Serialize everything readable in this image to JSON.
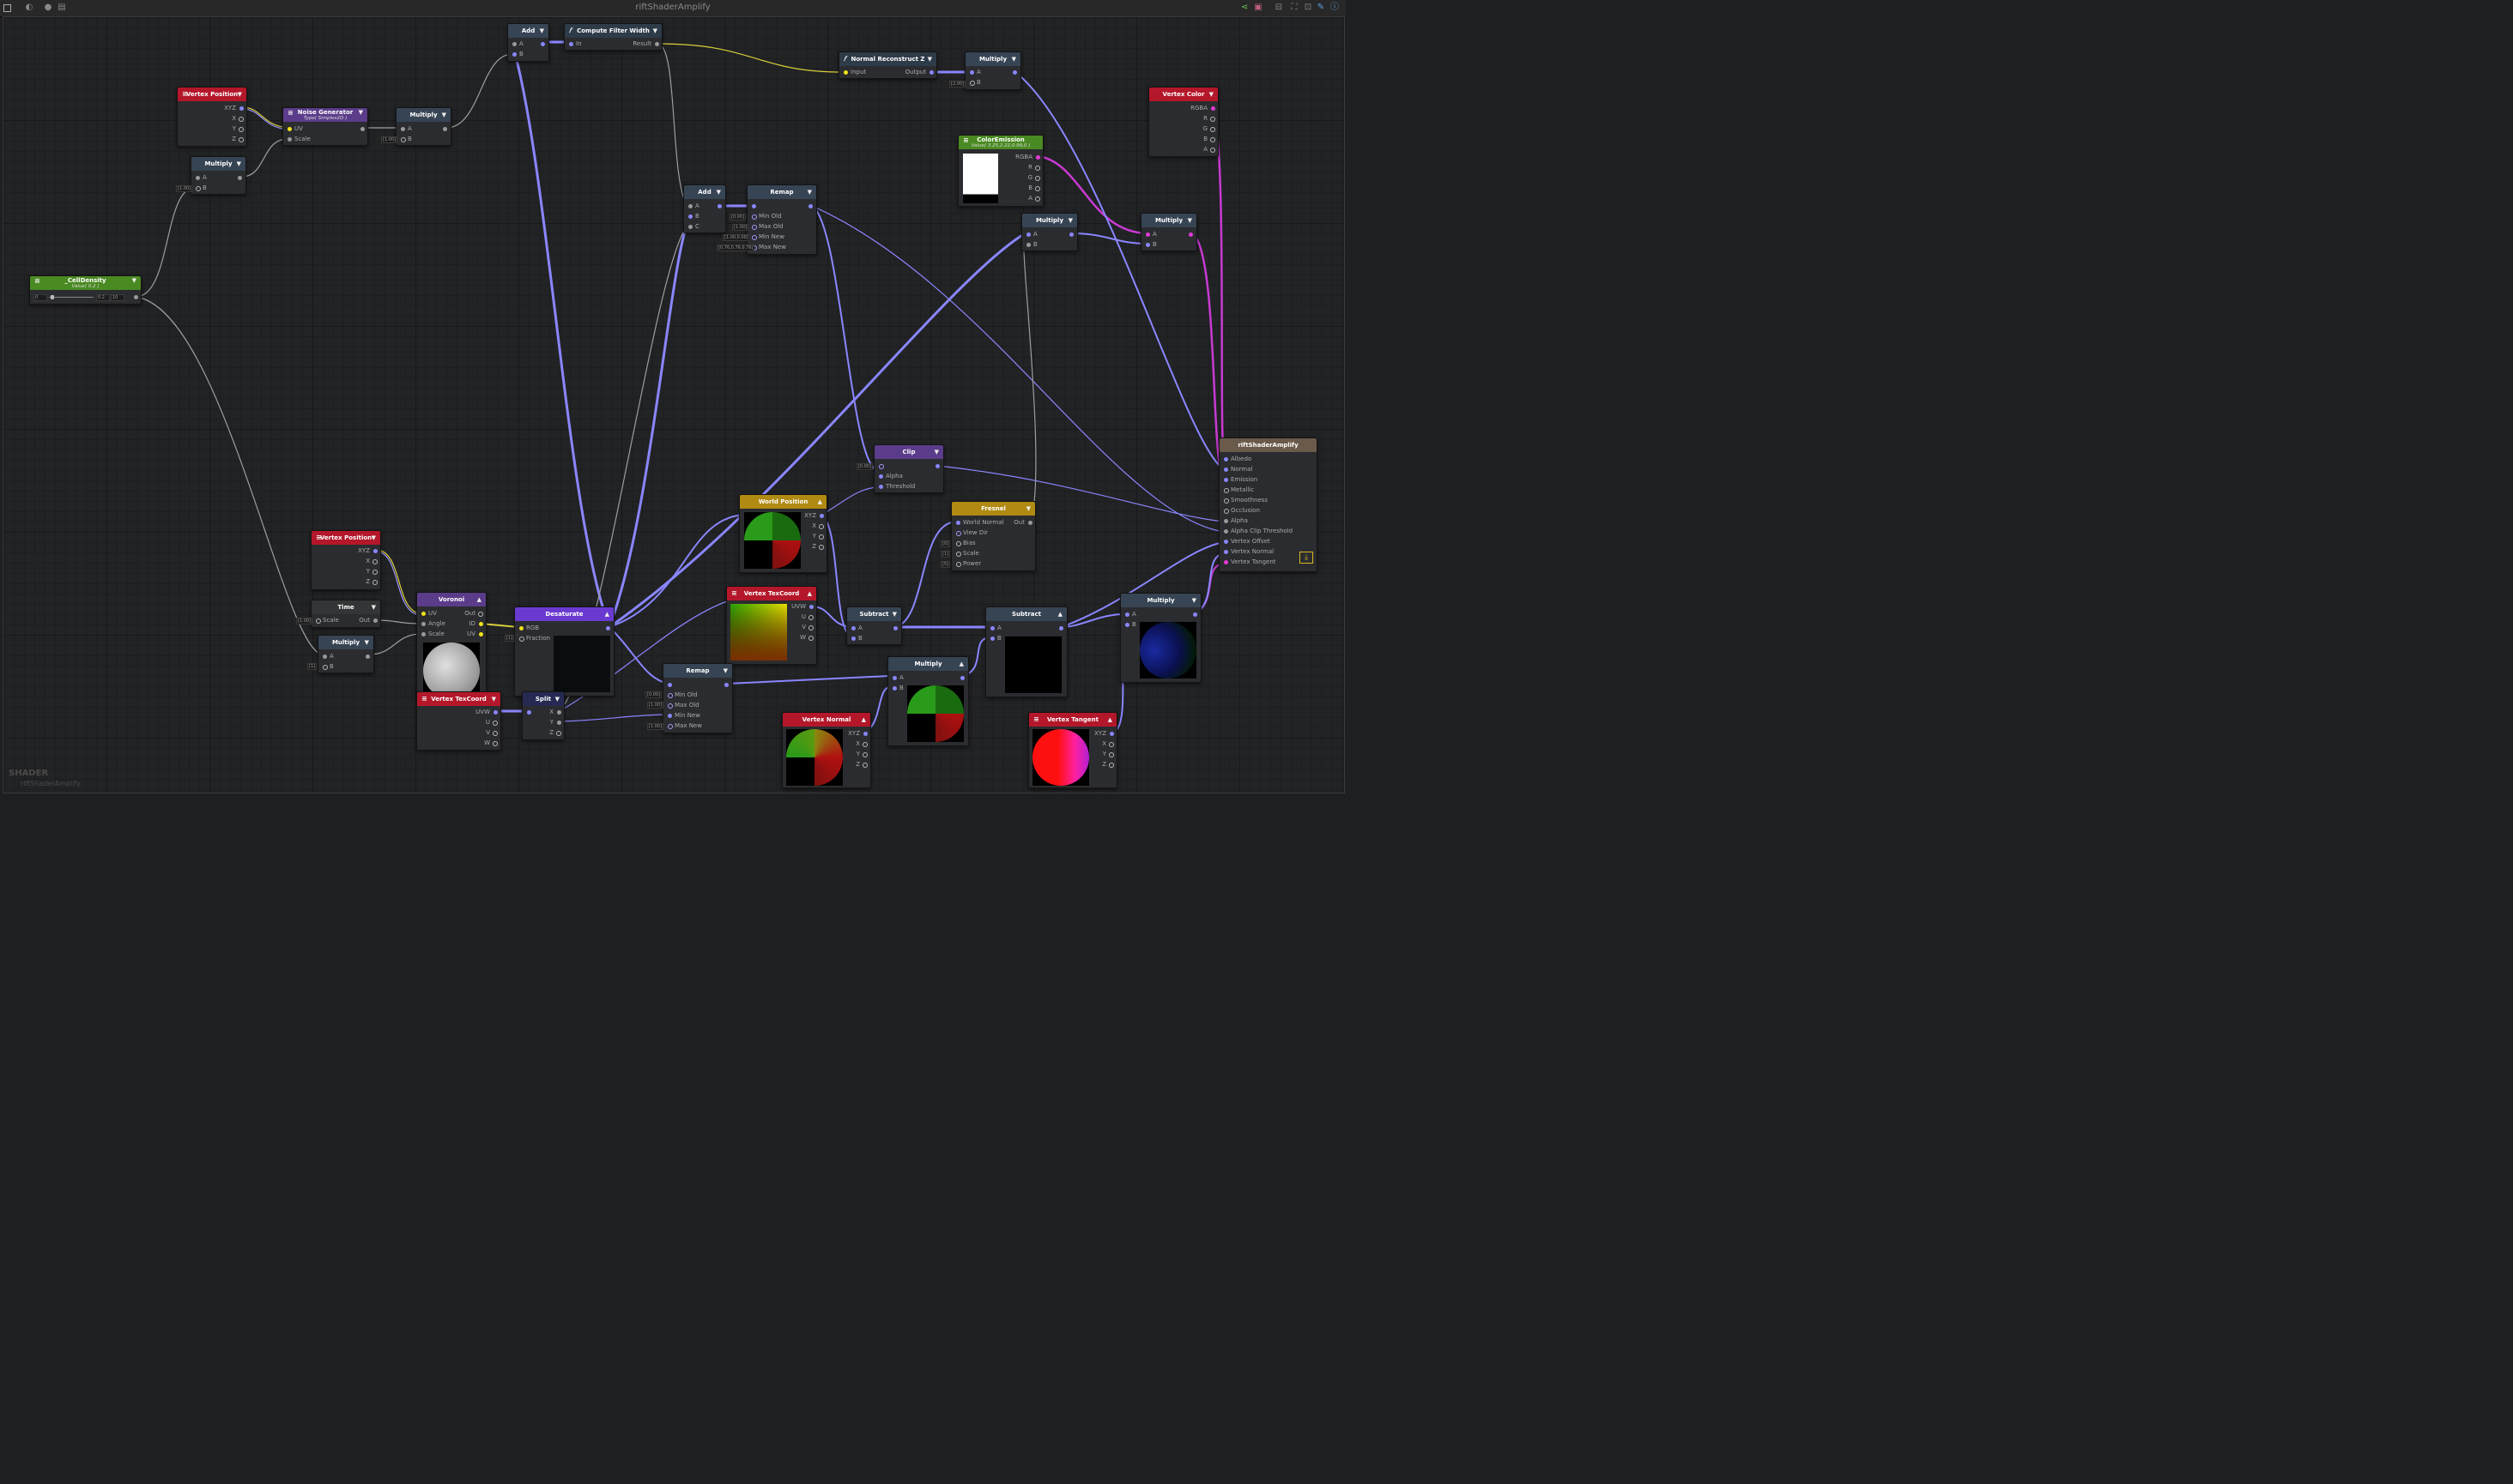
{
  "window": {
    "title": "riftShaderAmplify"
  },
  "watermark": {
    "type": "SHADER",
    "name": "riftShaderAmplify"
  },
  "nodes": {
    "vertex_position_1": {
      "title": "Vertex Position",
      "ports": [
        "XYZ",
        "X",
        "Y",
        "Z"
      ]
    },
    "noise_generator": {
      "title": "Noise Generator",
      "subtitle": "Type( Simplex2D )",
      "ports": [
        "UV",
        "Scale"
      ]
    },
    "multiply_1": {
      "title": "Multiply",
      "ports": [
        "A",
        "B"
      ],
      "b_value": "[1.00]"
    },
    "multiply_2": {
      "title": "Multiply",
      "ports": [
        "A",
        "B"
      ],
      "b_value": "[1.00]"
    },
    "add_1": {
      "title": "Add",
      "ports": [
        "A",
        "B"
      ]
    },
    "compute_filter_width": {
      "title": "Compute Filter Width",
      "in": "In",
      "out": "Result"
    },
    "normal_reconstruct": {
      "title": "Normal Reconstruct Z",
      "in": "Input",
      "out": "Output"
    },
    "multiply_3": {
      "title": "Multiply",
      "ports": [
        "A",
        "B"
      ],
      "a_value": "[2.00]"
    },
    "vertex_color": {
      "title": "Vertex Color",
      "ports": [
        "RGBA",
        "R",
        "G",
        "B",
        "A"
      ]
    },
    "color_emission": {
      "title": "ColorEmission",
      "subtitle": "Value( 3.25,2.22,0.99,0 )",
      "ports": [
        "RGBA",
        "R",
        "G",
        "B",
        "A"
      ]
    },
    "celldensity": {
      "title": "_CellDensity",
      "subtitle": "Value( 0.2 )",
      "min": "0",
      "value": "0.2",
      "max": "10"
    },
    "add_2": {
      "title": "Add",
      "ports": [
        "A",
        "B",
        "C"
      ],
      "c_value": "[0.00]"
    },
    "remap_1": {
      "title": "Remap",
      "ports": [
        "",
        "Min Old",
        "Max Old",
        "Min New",
        "Max New"
      ],
      "values": [
        "[0.00]",
        "[1.00]",
        "[1.00,0.00]",
        "[0.76,0.76,0.76]"
      ]
    },
    "multiply_4": {
      "title": "Multiply",
      "ports": [
        "A",
        "B"
      ]
    },
    "multiply_5": {
      "title": "Multiply",
      "ports": [
        "A",
        "B"
      ]
    },
    "riftshader": {
      "title": "riftShaderAmplify",
      "ports": [
        "Albedo",
        "Normal",
        "Emission",
        "Metallic",
        "Smoothness",
        "Occlusion",
        "Alpha",
        "Alpha Clip Threshold",
        "Vertex Offset",
        "Vertex Normal",
        "Vertex Tangent"
      ]
    },
    "clip": {
      "title": "Clip",
      "ports": [
        "",
        "Alpha",
        "Threshold"
      ],
      "value": "[0.00]"
    },
    "world_position": {
      "title": "World Position",
      "ports": [
        "XYZ",
        "X",
        "Y",
        "Z"
      ]
    },
    "fresnel": {
      "title": "Fresnel",
      "ports": [
        "World Normal",
        "View Dir",
        "Bias",
        "Scale",
        "Power"
      ],
      "out": "Out",
      "values": [
        "[0]",
        "[1]",
        "[5]"
      ]
    },
    "vertex_position_2": {
      "title": "Vertex Position",
      "ports": [
        "XYZ",
        "X",
        "Y",
        "Z"
      ]
    },
    "time": {
      "title": "Time",
      "in": "Scale",
      "out": "Out",
      "value": "[1.00]"
    },
    "multiply_6": {
      "title": "Multiply",
      "ports": [
        "A",
        "B"
      ],
      "b_value": "[1]"
    },
    "voronoi": {
      "title": "Voronoi",
      "ports": [
        "UV",
        "Angle",
        "Scale"
      ],
      "outs": [
        "Out",
        "ID",
        "UV"
      ]
    },
    "desaturate": {
      "title": "Desaturate",
      "ports": [
        "RGB",
        "Fraction"
      ],
      "value": "[1]"
    },
    "vertex_texcoord_1": {
      "title": "Vertex TexCoord",
      "ports": [
        "UVW",
        "U",
        "V",
        "W"
      ]
    },
    "split": {
      "title": "Split",
      "ports": [
        "X",
        "Y",
        "Z"
      ]
    },
    "vertex_texcoord_2": {
      "title": "Vertex TexCoord",
      "ports": [
        "UVW",
        "U",
        "V",
        "W"
      ]
    },
    "subtract_1": {
      "title": "Subtract",
      "ports": [
        "A",
        "B"
      ]
    },
    "subtract_2": {
      "title": "Subtract",
      "ports": [
        "A",
        "B"
      ]
    },
    "remap_2": {
      "title": "Remap",
      "ports": [
        "",
        "Min Old",
        "Max Old",
        "Min New",
        "Max New"
      ],
      "values": [
        "[0.00]",
        "[1.00]",
        "[0.00]",
        "[1.00]"
      ]
    },
    "multiply_7": {
      "title": "Multiply",
      "ports": [
        "A",
        "B"
      ]
    },
    "multiply_8": {
      "title": "Multiply",
      "ports": [
        "A",
        "B"
      ]
    },
    "vertex_normal": {
      "title": "Vertex Normal",
      "ports": [
        "XYZ",
        "X",
        "Y",
        "Z"
      ]
    },
    "vertex_tangent": {
      "title": "Vertex Tangent",
      "ports": [
        "XYZ",
        "X",
        "Y",
        "Z"
      ]
    }
  },
  "colors": {
    "wire_float": "#7b74e8",
    "wire_color": "#c83ad2",
    "wire_yellow": "#d8cf3a",
    "wire_gray": "#8e8e8e",
    "header_red": "#b4172a",
    "header_green": "#4a8a22",
    "header_gold": "#b08a12"
  }
}
